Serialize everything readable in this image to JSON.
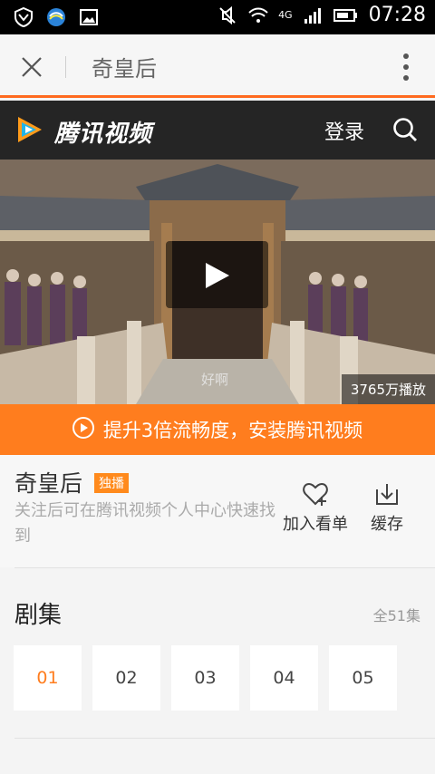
{
  "status_bar": {
    "time": "07:28",
    "network": "4G",
    "icons": [
      "shield-icon",
      "china-mobile-icon",
      "image-icon",
      "mute-icon",
      "wifi-icon",
      "signal-icon",
      "battery-icon"
    ]
  },
  "browser": {
    "title": "奇皇后",
    "icons": [
      "close-icon",
      "more-vertical-icon"
    ]
  },
  "app_header": {
    "logo_text": "腾讯视频",
    "login_label": "登录",
    "icons": [
      "logo-play-icon",
      "search-icon"
    ]
  },
  "video": {
    "views": "3765万播放",
    "subtitle_text": "好啊",
    "icons": [
      "play-icon"
    ]
  },
  "promo": {
    "text": "提升3倍流畅度，安装腾讯视频",
    "icons": [
      "logo-play-icon"
    ]
  },
  "show": {
    "title": "奇皇后",
    "badge": "独播",
    "description": "关注后可在腾讯视频个人中心快速找到",
    "actions": {
      "add_label": "加入看单",
      "cache_label": "缓存"
    }
  },
  "episodes": {
    "title": "剧集",
    "count": "全51集",
    "items": [
      "01",
      "02",
      "03",
      "04",
      "05"
    ],
    "selected": "01"
  },
  "colors": {
    "accent": "#ff7d1e",
    "header_bg": "#252525",
    "statusbar_bg": "#000000"
  }
}
